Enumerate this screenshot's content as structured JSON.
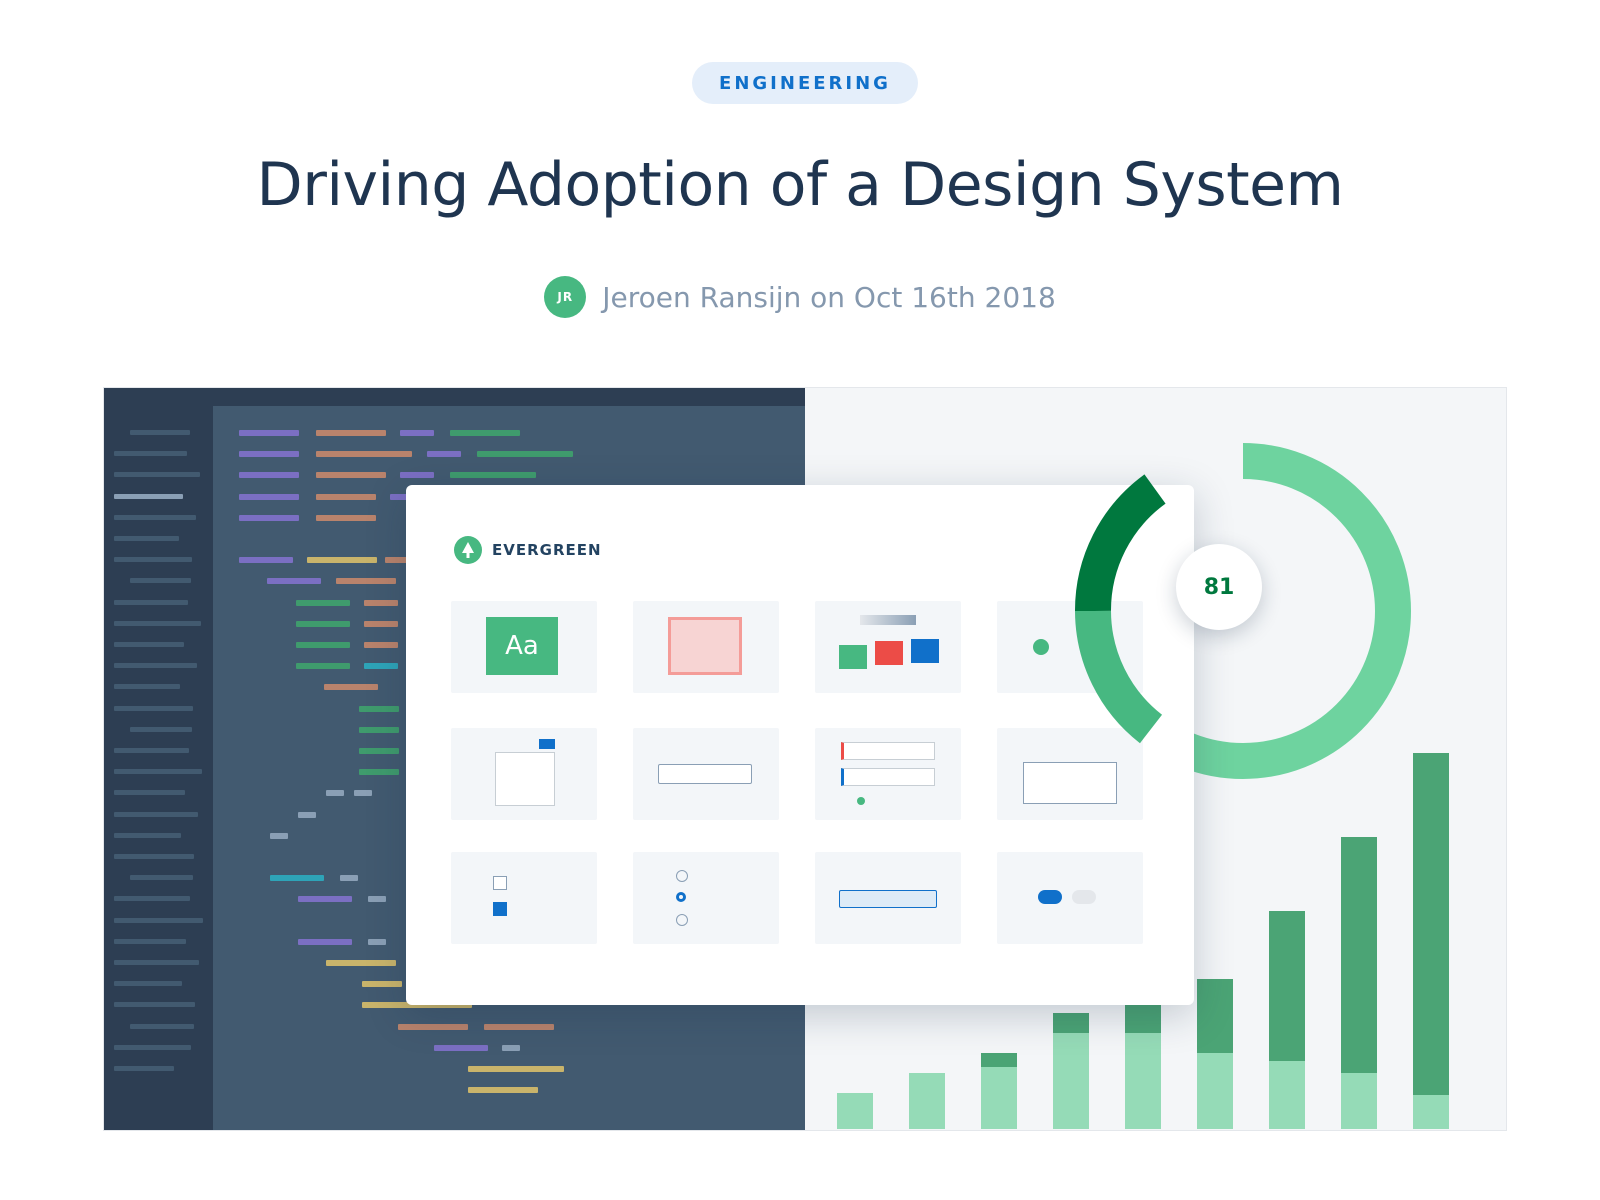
{
  "post": {
    "category": "ENGINEERING",
    "title": "Driving Adoption of a Design System",
    "author_initials": "JR",
    "byline": "Jeroen Ransijn on Oct 16th 2018"
  },
  "hero": {
    "brand_name": "EVERGREEN",
    "tile_glyph": "Aa",
    "score": "81",
    "score_fraction": 0.81,
    "colors": {
      "editor_dark": "#2d3e53",
      "editor": "#425a70",
      "green": "#47b881",
      "dark_green": "#00783e",
      "light_green": "#6ed39f",
      "red": "#ec4c47",
      "blue": "#1070ca",
      "purple": "#7b6fc3",
      "orange": "#b9836c",
      "yellow": "#c9b46b",
      "teal": "#2ea4b8"
    }
  }
}
